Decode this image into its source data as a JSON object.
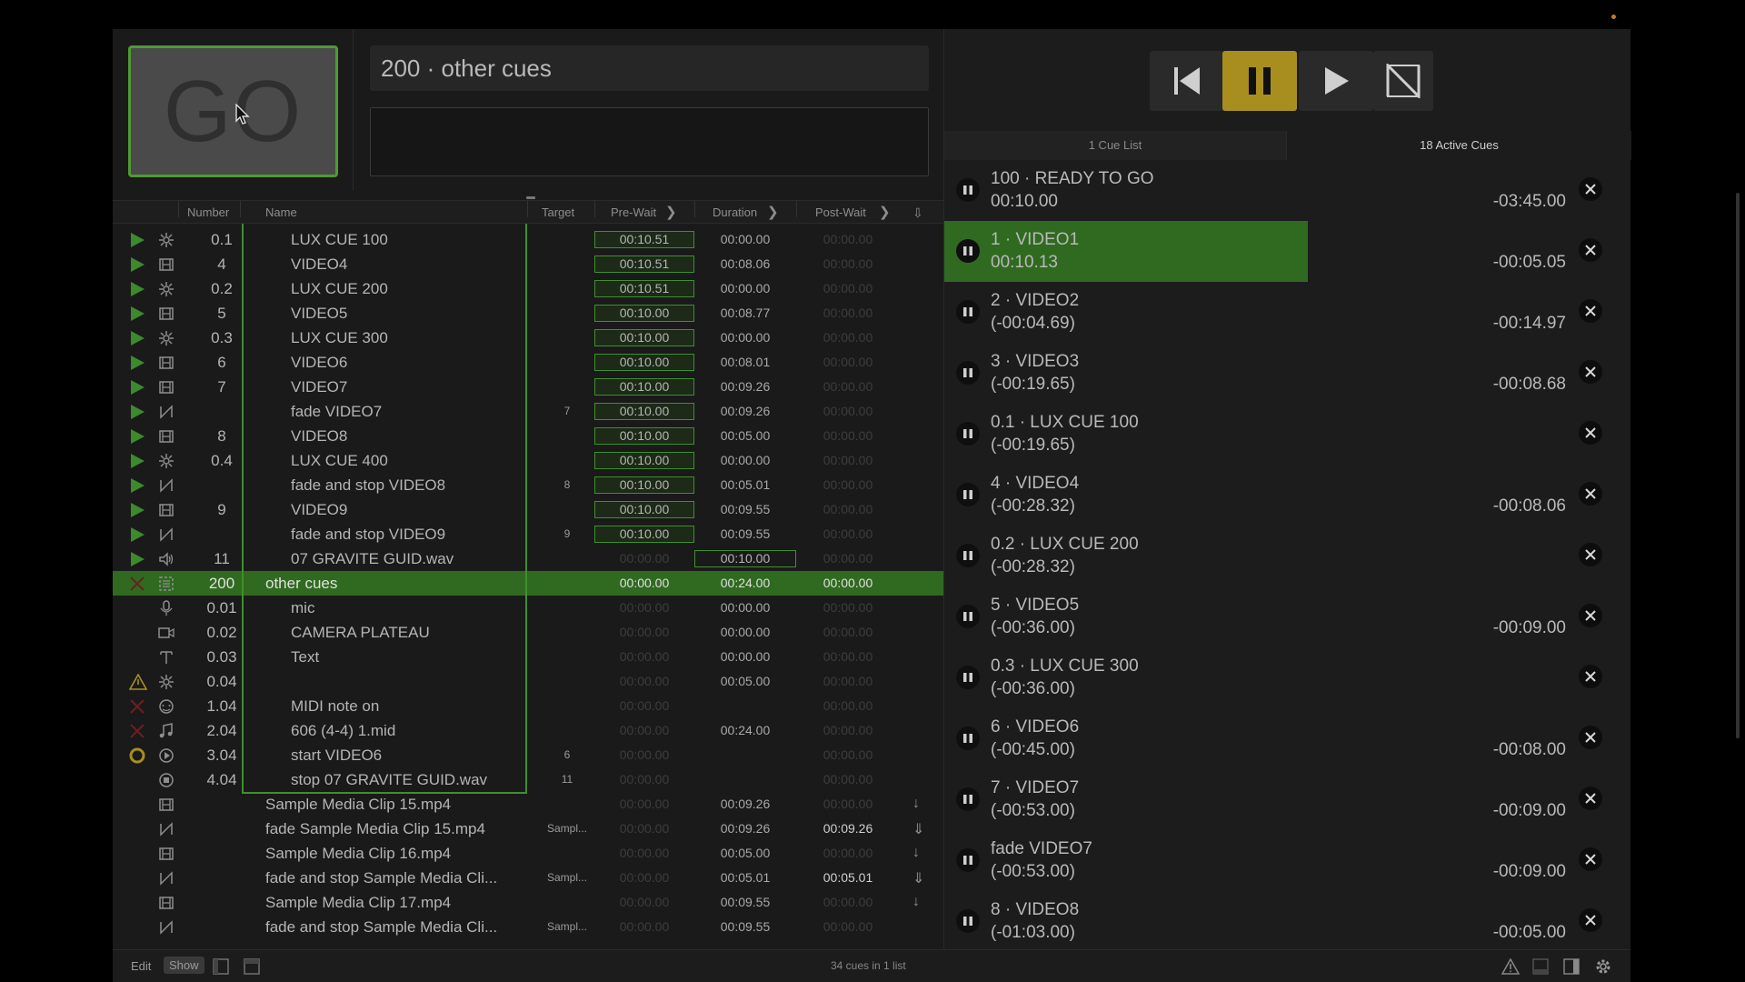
{
  "go_button": {
    "label": "GO"
  },
  "current_cue": {
    "title": "200 · other cues",
    "notes": ""
  },
  "columns": {
    "number": "Number",
    "name": "Name",
    "target": "Target",
    "prewait": "Pre-Wait",
    "duration": "Duration",
    "postwait": "Post-Wait"
  },
  "rows": [
    {
      "state": "play",
      "type": "light",
      "number": "0.1",
      "name": "LUX CUE 100",
      "indent": true,
      "target": "",
      "prewait": "00:10.51",
      "prewait_box": true,
      "duration": "00:00.00",
      "postwait": "00:00.00"
    },
    {
      "state": "play",
      "type": "video",
      "number": "4",
      "name": "VIDEO4",
      "indent": true,
      "target": "",
      "prewait": "00:10.51",
      "prewait_box": true,
      "duration": "00:08.06",
      "postwait": "00:00.00"
    },
    {
      "state": "play",
      "type": "light",
      "number": "0.2",
      "name": "LUX CUE 200",
      "indent": true,
      "target": "",
      "prewait": "00:10.51",
      "prewait_box": true,
      "duration": "00:00.00",
      "postwait": "00:00.00"
    },
    {
      "state": "play",
      "type": "video",
      "number": "5",
      "name": "VIDEO5",
      "indent": true,
      "target": "",
      "prewait": "00:10.00",
      "prewait_box": true,
      "duration": "00:08.77",
      "postwait": "00:00.00"
    },
    {
      "state": "play",
      "type": "light",
      "number": "0.3",
      "name": "LUX CUE 300",
      "indent": true,
      "target": "",
      "prewait": "00:10.00",
      "prewait_box": true,
      "duration": "00:00.00",
      "postwait": "00:00.00"
    },
    {
      "state": "play",
      "type": "video",
      "number": "6",
      "name": "VIDEO6",
      "indent": true,
      "target": "",
      "prewait": "00:10.00",
      "prewait_box": true,
      "duration": "00:08.01",
      "postwait": "00:00.00"
    },
    {
      "state": "play",
      "type": "video",
      "number": "7",
      "name": "VIDEO7",
      "indent": true,
      "target": "",
      "prewait": "00:10.00",
      "prewait_box": true,
      "duration": "00:09.26",
      "postwait": "00:00.00"
    },
    {
      "state": "play",
      "type": "fade",
      "number": "",
      "name": "fade VIDEO7",
      "indent": true,
      "target": "7",
      "prewait": "00:10.00",
      "prewait_box": true,
      "duration": "00:09.26",
      "postwait": "00:00.00"
    },
    {
      "state": "play",
      "type": "video",
      "number": "8",
      "name": "VIDEO8",
      "indent": true,
      "target": "",
      "prewait": "00:10.00",
      "prewait_box": true,
      "duration": "00:05.00",
      "postwait": "00:00.00"
    },
    {
      "state": "play",
      "type": "light",
      "number": "0.4",
      "name": "LUX CUE 400",
      "indent": true,
      "target": "",
      "prewait": "00:10.00",
      "prewait_box": true,
      "duration": "00:00.00",
      "postwait": "00:00.00"
    },
    {
      "state": "play",
      "type": "fade",
      "number": "",
      "name": "fade and stop VIDEO8",
      "indent": true,
      "target": "8",
      "prewait": "00:10.00",
      "prewait_box": true,
      "duration": "00:05.01",
      "postwait": "00:00.00"
    },
    {
      "state": "play",
      "type": "video",
      "number": "9",
      "name": "VIDEO9",
      "indent": true,
      "target": "",
      "prewait": "00:10.00",
      "prewait_box": true,
      "duration": "00:09.55",
      "postwait": "00:00.00"
    },
    {
      "state": "play",
      "type": "fade",
      "number": "",
      "name": "fade and stop VIDEO9",
      "indent": true,
      "target": "9",
      "prewait": "00:10.00",
      "prewait_box": true,
      "duration": "00:09.55",
      "postwait": "00:00.00"
    },
    {
      "state": "play",
      "type": "audio",
      "number": "11",
      "name": "07 GRAVITE GUID.wav",
      "indent": true,
      "target": "",
      "prewait": "00:00.00",
      "prewait_box": false,
      "prewait_dim": true,
      "duration": "00:10.00",
      "duration_box": true,
      "postwait": "00:00.00"
    },
    {
      "state": "broken",
      "type": "group",
      "number": "200",
      "name": "other cues",
      "indent": false,
      "selected": true,
      "target": "",
      "prewait": "00:00.00",
      "prewait_box": false,
      "duration": "00:24.00",
      "postwait": "00:00.00",
      "postwait_lit": true
    },
    {
      "state": "",
      "type": "mic",
      "number": "0.01",
      "name": "mic",
      "indent": true,
      "target": "",
      "prewait": "00:00.00",
      "prewait_dim": true,
      "duration": "00:00.00",
      "postwait": "00:00.00"
    },
    {
      "state": "",
      "type": "camera",
      "number": "0.02",
      "name": "CAMERA PLATEAU",
      "indent": true,
      "target": "",
      "prewait": "00:00.00",
      "prewait_dim": true,
      "duration": "00:00.00",
      "postwait": "00:00.00"
    },
    {
      "state": "",
      "type": "text",
      "number": "0.03",
      "name": "Text",
      "indent": true,
      "target": "",
      "prewait": "00:00.00",
      "prewait_dim": true,
      "duration": "00:00.00",
      "postwait": "00:00.00"
    },
    {
      "state": "warning",
      "type": "light",
      "number": "0.04",
      "name": "",
      "indent": true,
      "target": "",
      "prewait": "00:00.00",
      "prewait_dim": true,
      "duration": "00:05.00",
      "postwait": "00:00.00"
    },
    {
      "state": "broken",
      "type": "midi",
      "number": "1.04",
      "name": "MIDI note on",
      "indent": true,
      "target": "",
      "prewait": "00:00.00",
      "prewait_dim": true,
      "duration": "",
      "postwait": "00:00.00"
    },
    {
      "state": "broken",
      "type": "music",
      "number": "2.04",
      "name": "606 (4-4) 1.mid",
      "indent": true,
      "target": "",
      "prewait": "00:00.00",
      "prewait_dim": true,
      "duration": "00:24.00",
      "postwait": "00:00.00"
    },
    {
      "state": "standby",
      "type": "start",
      "number": "3.04",
      "name": "start VIDEO6",
      "indent": true,
      "target": "6",
      "prewait": "00:00.00",
      "prewait_dim": true,
      "duration": "",
      "postwait": "00:00.00"
    },
    {
      "state": "",
      "type": "stop",
      "number": "4.04",
      "name": "stop 07 GRAVITE GUID.wav",
      "indent": true,
      "target": "11",
      "prewait": "00:00.00",
      "prewait_dim": true,
      "duration": "",
      "postwait": "00:00.00"
    },
    {
      "state": "",
      "type": "video",
      "number": "",
      "name": "Sample Media Clip 15.mp4",
      "indent": false,
      "target": "",
      "prewait": "00:00.00",
      "prewait_dim": true,
      "duration": "00:09.26",
      "postwait": "00:00.00",
      "cont": "down"
    },
    {
      "state": "",
      "type": "fade",
      "number": "",
      "name": "fade Sample Media Clip 15.mp4",
      "indent": false,
      "target": "Sampl...",
      "prewait": "00:00.00",
      "prewait_dim": true,
      "duration": "00:09.26",
      "postwait": "00:09.26",
      "postwait_lit": true,
      "cont": "wait"
    },
    {
      "state": "",
      "type": "video",
      "number": "",
      "name": "Sample Media Clip 16.mp4",
      "indent": false,
      "target": "",
      "prewait": "00:00.00",
      "prewait_dim": true,
      "duration": "00:05.00",
      "postwait": "00:00.00",
      "cont": "down"
    },
    {
      "state": "",
      "type": "fade",
      "number": "",
      "name": "fade and stop Sample Media Cli...",
      "indent": false,
      "target": "Sampl...",
      "prewait": "00:00.00",
      "prewait_dim": true,
      "duration": "00:05.01",
      "postwait": "00:05.01",
      "postwait_lit": true,
      "cont": "wait"
    },
    {
      "state": "",
      "type": "video",
      "number": "",
      "name": "Sample Media Clip 17.mp4",
      "indent": false,
      "target": "",
      "prewait": "00:00.00",
      "prewait_dim": true,
      "duration": "00:09.55",
      "postwait": "00:00.00",
      "cont": "down"
    },
    {
      "state": "",
      "type": "fade",
      "number": "",
      "name": "fade and stop Sample Media Cli...",
      "indent": false,
      "target": "Sampl...",
      "prewait": "00:00.00",
      "prewait_dim": true,
      "duration": "00:09.55",
      "postwait": "00:00.00"
    }
  ],
  "footer": {
    "edit": "Edit",
    "show": "Show",
    "count": "34 cues in 1 list"
  },
  "tabs": {
    "cue_list": "1 Cue List",
    "active_cues": "18 Active Cues"
  },
  "active_cues": [
    {
      "title": "100 · READY TO GO",
      "time": "00:10.00",
      "remaining": "-03:45.00",
      "progress": 0
    },
    {
      "title": "1 · VIDEO1",
      "time": "00:10.13",
      "remaining": "-00:05.05",
      "progress": 0.54
    },
    {
      "title": "2 · VIDEO2",
      "time": "(-00:04.69)",
      "remaining": "-00:14.97",
      "progress": 0
    },
    {
      "title": "3 · VIDEO3",
      "time": "(-00:19.65)",
      "remaining": "-00:08.68",
      "progress": 0
    },
    {
      "title": "0.1 · LUX CUE 100",
      "time": "(-00:19.65)",
      "remaining": "",
      "progress": 0
    },
    {
      "title": "4 · VIDEO4",
      "time": "(-00:28.32)",
      "remaining": "-00:08.06",
      "progress": 0
    },
    {
      "title": "0.2 · LUX CUE 200",
      "time": "(-00:28.32)",
      "remaining": "",
      "progress": 0
    },
    {
      "title": "5 · VIDEO5",
      "time": "(-00:36.00)",
      "remaining": "-00:09.00",
      "progress": 0
    },
    {
      "title": "0.3 · LUX CUE 300",
      "time": "(-00:36.00)",
      "remaining": "",
      "progress": 0
    },
    {
      "title": "6 · VIDEO6",
      "time": "(-00:45.00)",
      "remaining": "-00:08.00",
      "progress": 0
    },
    {
      "title": "7 · VIDEO7",
      "time": "(-00:53.00)",
      "remaining": "-00:09.00",
      "progress": 0
    },
    {
      "title": "fade VIDEO7",
      "time": "(-00:53.00)",
      "remaining": "-00:09.00",
      "progress": 0
    },
    {
      "title": "8 · VIDEO8",
      "time": "(-01:03.00)",
      "remaining": "-00:05.00",
      "progress": 0
    }
  ],
  "colors": {
    "accent_green": "#3f8f2e",
    "pause_yellow": "#a88e1f",
    "selected_row": "#2f6a20"
  }
}
